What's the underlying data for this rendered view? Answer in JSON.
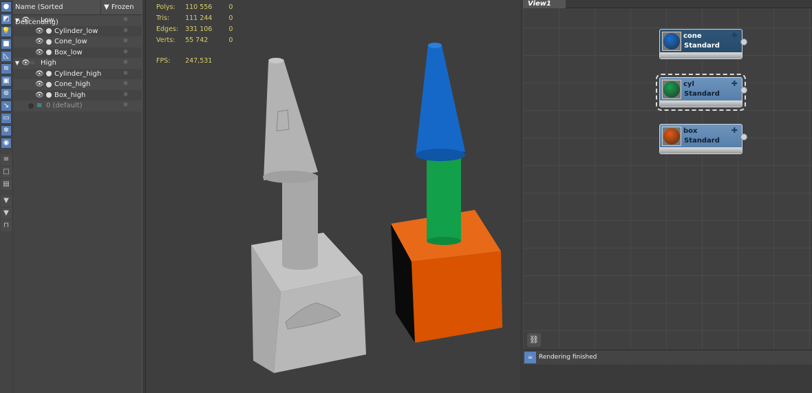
{
  "toolbar": {
    "icons": [
      "sphere",
      "shapes",
      "light",
      "camera",
      "helper",
      "spacewarp",
      "group",
      "xref",
      "bone",
      "container",
      "frozen",
      "visibility",
      "layer-list",
      "blank",
      "properties",
      "filter-settings",
      "filter",
      "lock"
    ]
  },
  "explorer": {
    "header": {
      "name": "Name (Sorted Descending)",
      "frozen": "Frozen"
    },
    "rows": [
      {
        "label": "Low",
        "type": "layer"
      },
      {
        "label": "Cylinder_low",
        "type": "object"
      },
      {
        "label": "Cone_low",
        "type": "object"
      },
      {
        "label": "Box_low",
        "type": "object"
      },
      {
        "label": "High",
        "type": "layer"
      },
      {
        "label": "Cylinder_high",
        "type": "object"
      },
      {
        "label": "Cone_high",
        "type": "object"
      },
      {
        "label": "Box_high",
        "type": "object"
      },
      {
        "label": "0 (default)",
        "type": "default-layer"
      }
    ]
  },
  "stats": [
    {
      "label": "Polys:",
      "value": "110 556",
      "sel": "0"
    },
    {
      "label": "Tris:",
      "value": "111 244",
      "sel": "0"
    },
    {
      "label": "Edges:",
      "value": "331 106",
      "sel": "0"
    },
    {
      "label": "Verts:",
      "value": "55 742",
      "sel": "0"
    }
  ],
  "fps": {
    "label": "FPS:",
    "value": "247,531"
  },
  "slate": {
    "tab": "View1",
    "nodes": [
      {
        "name": "cone",
        "type": "Standard",
        "color": "#1a6fd0",
        "selected": true
      },
      {
        "name": "cyl",
        "type": "Standard",
        "color": "#18a050",
        "selected": false
      },
      {
        "name": "box",
        "type": "Standard",
        "color": "#e85a10",
        "selected": false
      }
    ]
  },
  "status": {
    "text": "Rendering finished"
  },
  "colors": {
    "cone": "#1668c8",
    "cylinder": "#12a04a",
    "box": "#e35a05",
    "gray": "#b5b5b5"
  }
}
